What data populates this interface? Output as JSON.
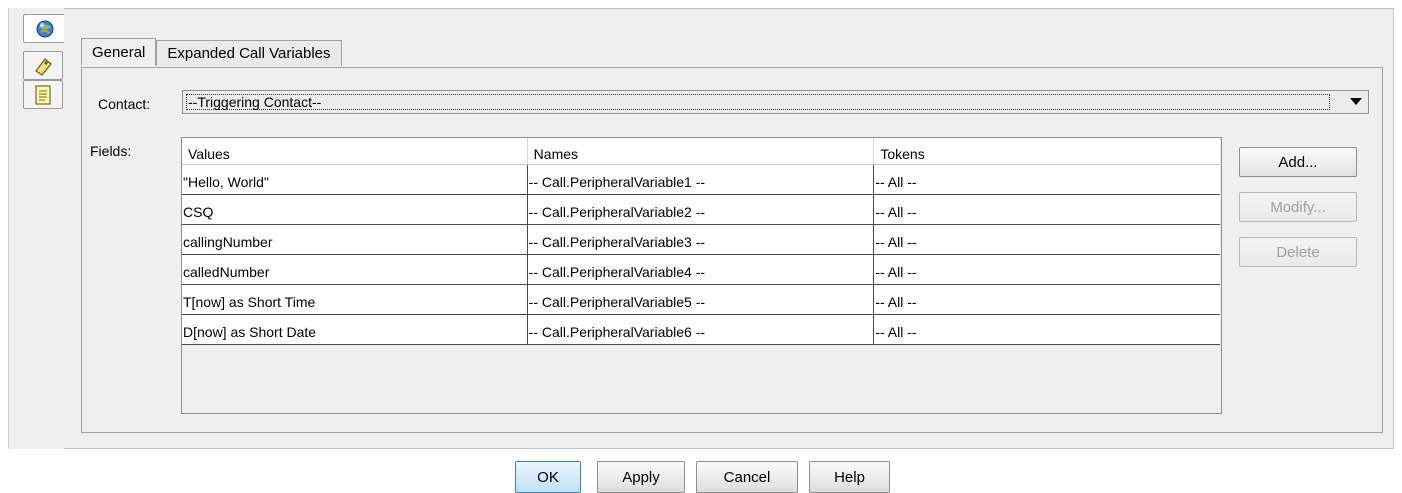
{
  "rail": {
    "tabs": [
      {
        "icon": "ball-icon"
      },
      {
        "icon": "tag-icon"
      },
      {
        "icon": "document-icon"
      }
    ]
  },
  "tabs": [
    {
      "label": "General"
    },
    {
      "label": "Expanded Call Variables"
    }
  ],
  "contact": {
    "label": "Contact:",
    "value": "--Triggering Contact--"
  },
  "fields": {
    "label": "Fields:",
    "columns": [
      "Values",
      "Names",
      "Tokens"
    ],
    "rows": [
      [
        "\"Hello, World\"",
        "-- Call.PeripheralVariable1 --",
        "-- All --"
      ],
      [
        "CSQ",
        "-- Call.PeripheralVariable2 --",
        "-- All --"
      ],
      [
        "callingNumber",
        "-- Call.PeripheralVariable3 --",
        "-- All --"
      ],
      [
        "calledNumber",
        "-- Call.PeripheralVariable4 --",
        "-- All --"
      ],
      [
        "T[now] as Short Time",
        "-- Call.PeripheralVariable5 --",
        "-- All --"
      ],
      [
        "D[now] as Short Date",
        "-- Call.PeripheralVariable6 --",
        "-- All --"
      ]
    ]
  },
  "side_buttons": {
    "add": "Add...",
    "modify": "Modify...",
    "delete": "Delete"
  },
  "bottom_buttons": {
    "ok": "OK",
    "apply": "Apply",
    "cancel": "Cancel",
    "help": "Help"
  }
}
